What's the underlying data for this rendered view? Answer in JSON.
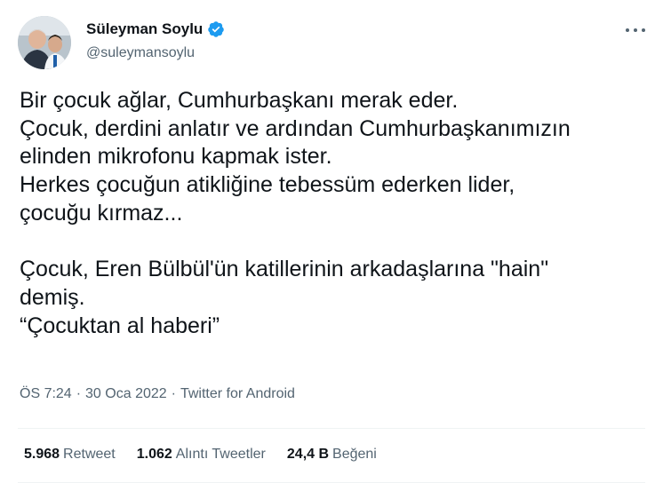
{
  "author": {
    "name": "Süleyman Soylu",
    "handle": "@suleymansoylu",
    "verified": true,
    "verified_color": "#1d9bf0"
  },
  "tweet": {
    "lines": [
      "Bir çocuk ağlar, Cumhurbaşkanı merak eder.",
      "Çocuk, derdini anlatır ve ardından Cumhurbaşkanımızın",
      "elinden mikrofonu kapmak ister.",
      "Herkes çocuğun atikliğine tebessüm ederken lider,",
      "çocuğu kırmaz...",
      "",
      "Çocuk, Eren Bülbül'ün katillerinin arkadaşlarına \"hain\"",
      "demiş.",
      "“Çocuktan al haberi”"
    ]
  },
  "meta": {
    "time": "ÖS 7:24",
    "date": "30 Oca 2022",
    "source": "Twitter for Android",
    "separator": "·"
  },
  "stats": {
    "retweets": {
      "count": "5.968",
      "label": "Retweet"
    },
    "quotes": {
      "count": "1.062",
      "label": "Alıntı Tweetler"
    },
    "likes": {
      "count": "24,4 B",
      "label": "Beğeni"
    }
  },
  "icons": {
    "more": "more-horizontal-icon",
    "verified": "verified-badge-icon"
  }
}
